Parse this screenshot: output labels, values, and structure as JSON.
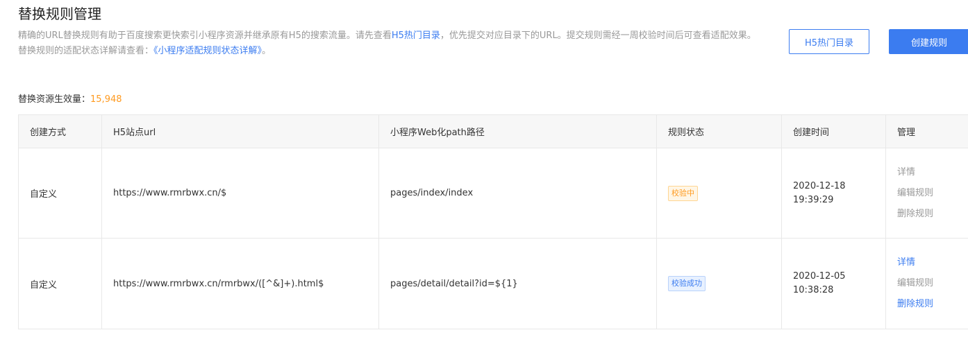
{
  "page": {
    "title": "替换规则管理",
    "desc_part1": "精确的URL替换规则有助于百度搜索更快索引小程序资源并继承原有H5的搜索流量。请先查看",
    "desc_link": "H5热门目录",
    "desc_part2": "，优先提交对应目录下的URL。提交规则需经一周校验时间后可查看适",
    "desc_part3": "配效果。",
    "status_note_prefix": "替换规则的适配状态详解请查看：",
    "status_note_link": "《小程序适配规则状态详解》",
    "status_note_suffix": "。"
  },
  "buttons": {
    "hot_dir": "H5热门目录",
    "create_rule": "创建规则"
  },
  "summary": {
    "label": "替换资源生效量：",
    "count": "15,948"
  },
  "table": {
    "headers": {
      "method": "创建方式",
      "h5_url": "H5站点url",
      "path": "小程序Web化path路径",
      "status": "规则状态",
      "created": "创建时间",
      "manage": "管理"
    },
    "rows": [
      {
        "method": "自定义",
        "h5_url": "https://www.rmrbwx.cn/$",
        "path": "pages/index/index",
        "status": "校验中",
        "date": "2020-12-18",
        "time": "19:39:29",
        "action_detail": "详情",
        "action_edit": "编辑规则",
        "action_delete": "删除规则"
      },
      {
        "method": "自定义",
        "h5_url": "https://www.rmrbwx.cn/rmrbwx/([^&]+).html$",
        "path": "pages/detail/detail?id=${1}",
        "status": "校验成功",
        "date": "2020-12-05",
        "time": "10:38:28",
        "action_detail": "详情",
        "action_edit": "编辑规则",
        "action_delete": "删除规则"
      }
    ]
  },
  "colors": {
    "accent": "#3b7cf0",
    "count": "#ff9a1f",
    "muted_text": "#999999"
  }
}
